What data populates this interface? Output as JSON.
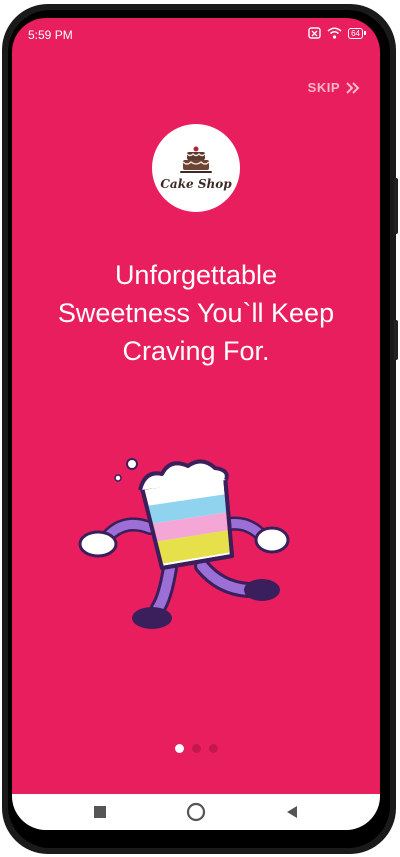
{
  "status_bar": {
    "time": "5:59 PM",
    "battery": "64"
  },
  "onboarding": {
    "skip_label": "SKIP",
    "logo_text": "Cake Shop",
    "headline_lines": [
      "Unforgettable",
      "Sweetness You`ll Keep",
      "Craving For."
    ],
    "page_count": 3,
    "active_page": 1
  },
  "icons": {
    "skip": "double-chevron-right-icon",
    "signal": "no-sim-icon",
    "wifi": "wifi-icon",
    "battery": "battery-icon",
    "recents": "square-icon",
    "home": "circle-icon",
    "back": "triangle-left-icon"
  },
  "colors": {
    "background": "#e91e5f",
    "text": "#ffffff",
    "skip": "#f7b8cc",
    "inactive_dot": "#c2184d"
  }
}
